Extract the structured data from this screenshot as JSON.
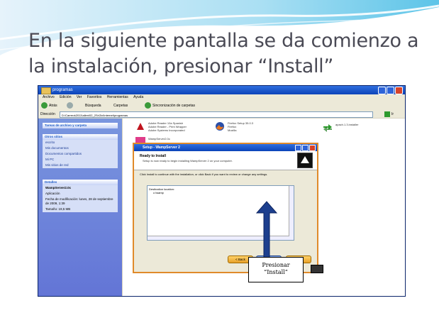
{
  "slide": {
    "title": "En la siguiente pantalla se da comienzo a la instalación, presionar “Install”"
  },
  "explorer": {
    "window_title": "programas",
    "menu": [
      "Archivo",
      "Edición",
      "Ver",
      "Favoritos",
      "Herramientas",
      "Ayuda"
    ],
    "toolbar": {
      "back": "Atrás",
      "search": "Búsqueda",
      "folders": "Carpetas",
      "sync": "Sincronización de carpetas"
    },
    "address_label": "Dirección",
    "address_value": "D:\\Carrera\\2011\\allen\\02_2Sr\\2ix\\Internet\\programas",
    "go_label": "Ir",
    "sidebar": {
      "tasks_header": "Tareas de archivo y carpeta",
      "other_header": "Otros sitios",
      "other_items": [
        "escrito",
        "Mis documentos",
        "Documentos compartidos",
        "Mi PC",
        "Mis sitios de red"
      ],
      "details_header": "Detalles",
      "details_lines": [
        "WampServer2.0c",
        "Aplicación",
        "Fecha de modificación: lunes, 28 de septiembre de 2009, 1:39",
        "Tamaño: 19,5 MB"
      ]
    },
    "files": [
      {
        "name": "Adobe Reader 10a Spanish",
        "desc": "Adobe Reader - Print Wrapper",
        "sub": "Adobe Systems Incorporated",
        "icon": "pdf-icon"
      },
      {
        "name": "Firefox Setup 35.0.3",
        "desc": "Firefox",
        "sub": "Mozilla",
        "icon": "firefox-icon"
      },
      {
        "name": "apach.1.3.installer",
        "desc": "",
        "sub": "",
        "icon": "green-arrows-icon"
      },
      {
        "name": "WampServer2.0c",
        "desc": "",
        "sub": "",
        "icon": "wamp-icon"
      }
    ]
  },
  "setup_dialog": {
    "title": "Setup - WampServer 2",
    "heading": "Ready to Install",
    "subheading": "Setup is now ready to begin installing WampServer 2 on your computer.",
    "body": "Click Install to continue with the installation, or click Back if you want to review or change any settings.",
    "destination_label": "Destination location:",
    "destination_value": "c:\\wamp",
    "buttons": {
      "back": "< Back",
      "install": "Install",
      "cancel": "Cancel"
    }
  },
  "callout": {
    "line1": "Presionar",
    "line2": "“Install”"
  },
  "colors": {
    "title_text": "#4a4a55",
    "xp_blue": "#0b43b8",
    "button_orange": "#e7a028",
    "install_blue": "#3c6fd0"
  }
}
